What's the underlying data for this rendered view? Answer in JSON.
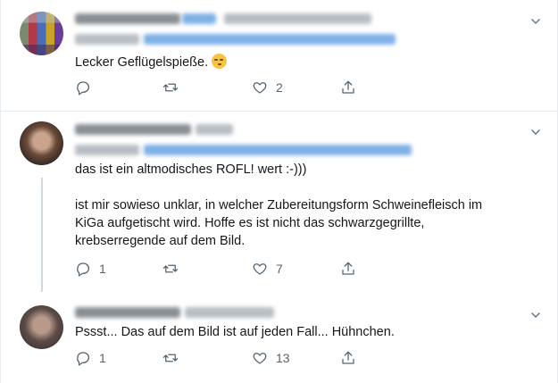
{
  "tweets": [
    {
      "text": "Lecker Geflügelspieße.",
      "emoji": "smirking-face",
      "actions": {
        "reply_count": "",
        "retweet_count": "",
        "like_count": "2"
      }
    },
    {
      "text_line1": "das ist ein altmodisches ROFL! wert :-)))",
      "text_line2": "ist mir sowieso unklar, in welcher Zubereitungsform Schweinefleisch im KiGa aufgetischt wird. Hoffe es ist nicht das schwarzgegrillte, krebserregende auf dem Bild.",
      "actions": {
        "reply_count": "1",
        "retweet_count": "",
        "like_count": "7"
      }
    },
    {
      "text": "Pssst... Das auf dem Bild ist auf jeden Fall... Hühnchen.",
      "actions": {
        "reply_count": "1",
        "retweet_count": "",
        "like_count": "13"
      }
    }
  ],
  "colors": {
    "text": "#14171a",
    "icon": "#536471",
    "border": "#e6ecf0",
    "link": "#1da1f2"
  },
  "icons": [
    "reply-icon",
    "retweet-icon",
    "like-icon",
    "share-icon",
    "chevron-down-icon"
  ]
}
